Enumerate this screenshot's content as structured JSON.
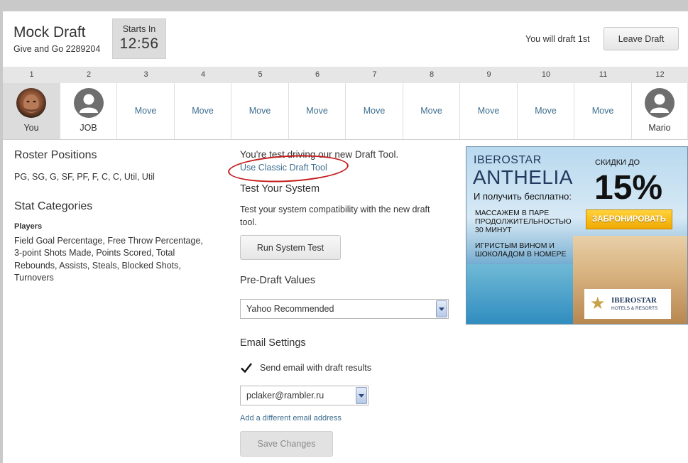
{
  "header": {
    "title": "Mock Draft",
    "subtitle": "Give and Go 2289204",
    "starts_label": "Starts In",
    "starts_time": "12:56",
    "draft_position": "You will draft 1st",
    "leave_label": "Leave Draft"
  },
  "board": {
    "picks": [
      {
        "num": "1",
        "label": "You",
        "type": "photo"
      },
      {
        "num": "2",
        "label": "JOB",
        "type": "avatar"
      },
      {
        "num": "3",
        "label": "Move",
        "type": "move"
      },
      {
        "num": "4",
        "label": "Move",
        "type": "move"
      },
      {
        "num": "5",
        "label": "Move",
        "type": "move"
      },
      {
        "num": "6",
        "label": "Move",
        "type": "move"
      },
      {
        "num": "7",
        "label": "Move",
        "type": "move"
      },
      {
        "num": "8",
        "label": "Move",
        "type": "move"
      },
      {
        "num": "9",
        "label": "Move",
        "type": "move"
      },
      {
        "num": "10",
        "label": "Move",
        "type": "move"
      },
      {
        "num": "11",
        "label": "Move",
        "type": "move"
      },
      {
        "num": "12",
        "label": "Mario",
        "type": "avatar"
      }
    ]
  },
  "left": {
    "roster_heading": "Roster Positions",
    "roster_positions": "PG, SG, G, SF, PF, F, C, C, Util, Util",
    "stat_heading": "Stat Categories",
    "players_label": "Players",
    "stats_line1": "Field Goal Percentage, Free Throw Percentage,",
    "stats_line2": "3-point Shots Made, Points Scored, Total",
    "stats_line3": "Rebounds, Assists, Steals, Blocked Shots,",
    "stats_line4": "Turnovers"
  },
  "middle": {
    "note": "You're test driving our new Draft Tool.",
    "classic_link": "Use Classic Draft Tool",
    "test_heading": "Test Your System",
    "test_text_line1": "Test your system compatibility with the new draft",
    "test_text_line2": "tool.",
    "run_test_label": "Run System Test",
    "predraft_heading": "Pre-Draft Values",
    "predraft_value": "Yahoo Recommended",
    "email_heading": "Email Settings",
    "send_email_label": "Send email with draft results",
    "send_email_checked": true,
    "email_value": "pclaker@rambler.ru",
    "add_email_link": "Add a different email address",
    "save_label": "Save Changes"
  },
  "ad": {
    "brand": "IBEROSTAR",
    "name": "ANTHELIA",
    "subtitle": "И получить бесплатно:",
    "text1": "МАССАЖЕМ В ПАРЕ ПРОДОЛЖИТЕЛЬНОСТЬЮ 30 МИНУТ",
    "text2": "ИГРИСТЫМ ВИНОМ И ШОКОЛАДОМ В НОМЕРЕ",
    "discount_label": "СКИДКИ ДО",
    "discount": "15%",
    "book_label": "ЗАБРОНИРОВАТЬ",
    "logo_name": "IBEROSTAR",
    "logo_sub": "HOTELS & RESORTS"
  }
}
